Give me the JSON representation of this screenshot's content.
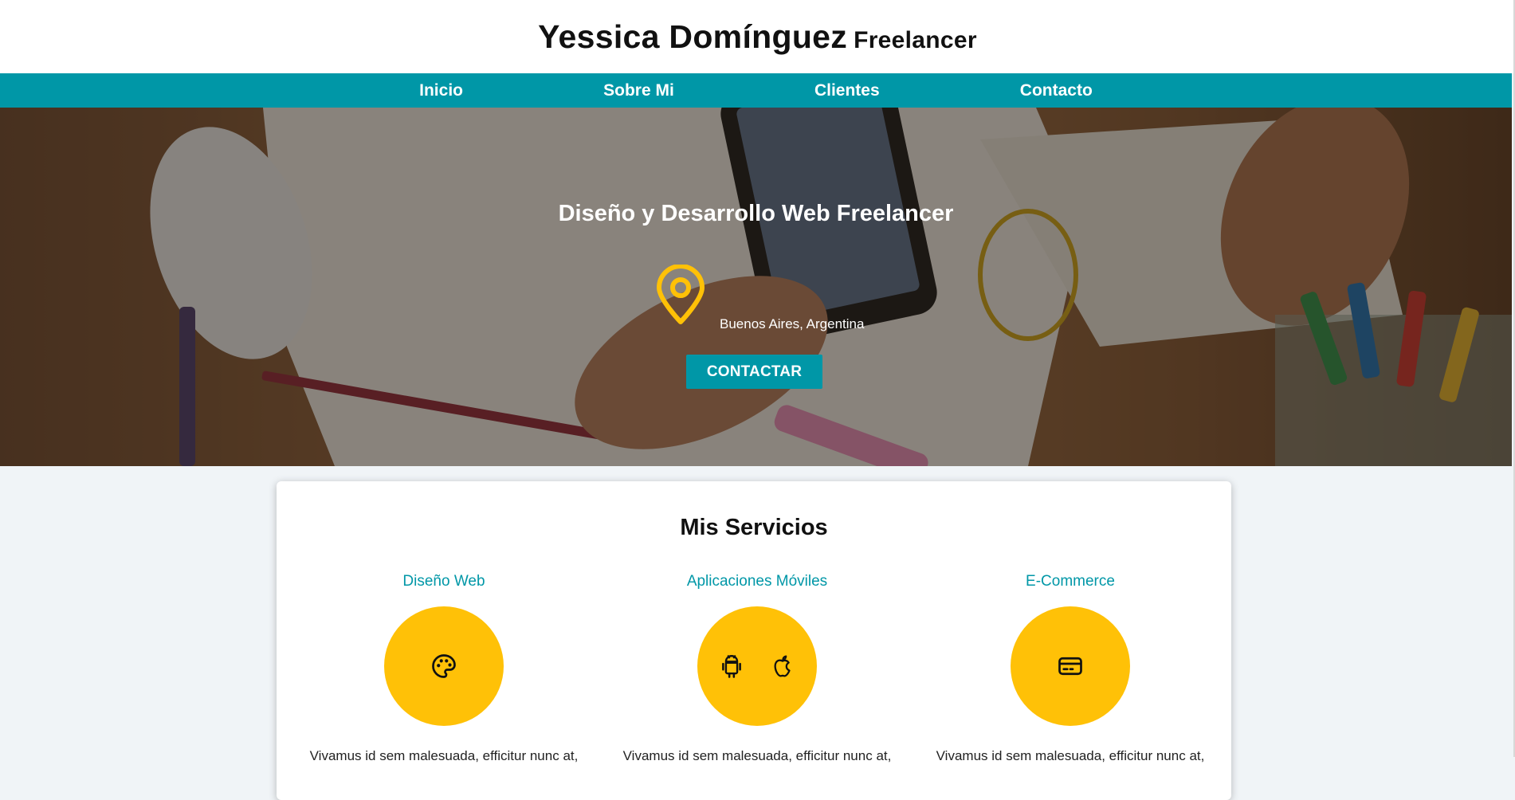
{
  "header": {
    "name": "Yessica Domínguez",
    "role": "Freelancer"
  },
  "nav": {
    "items": [
      {
        "label": "Inicio"
      },
      {
        "label": "Sobre Mi"
      },
      {
        "label": "Clientes"
      },
      {
        "label": "Contacto"
      }
    ]
  },
  "hero": {
    "heading": "Diseño y Desarrollo Web Freelancer",
    "location": "Buenos Aires, Argentina",
    "location_icon": "map-pin-icon",
    "cta_label": "CONTACTAR"
  },
  "services": {
    "title": "Mis Servicios",
    "items": [
      {
        "title": "Diseño Web",
        "icons": [
          "palette-icon"
        ],
        "text": "Vivamus id sem malesuada, efficitur nunc at,"
      },
      {
        "title": "Aplicaciones Móviles",
        "icons": [
          "android-icon",
          "apple-icon"
        ],
        "text": "Vivamus id sem malesuada, efficitur nunc at,"
      },
      {
        "title": "E-Commerce",
        "icons": [
          "credit-card-icon"
        ],
        "text": "Vivamus id sem malesuada, efficitur nunc at,"
      }
    ]
  },
  "colors": {
    "primary": "#0097a7",
    "accent": "#ffc107",
    "background": "#f0f4f7"
  }
}
